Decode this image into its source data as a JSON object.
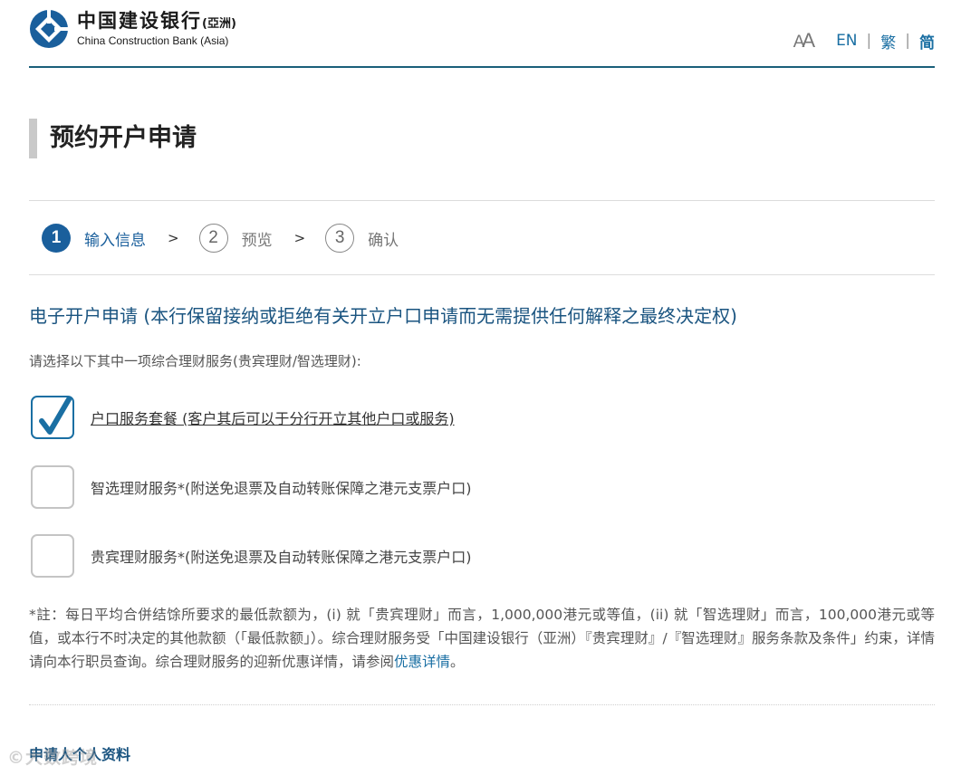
{
  "header": {
    "logo_cn": "中国建设银行",
    "logo_cn_suffix": "(亞洲)",
    "logo_en": "China Construction Bank (Asia)",
    "font_size_icon": "font-size-icon",
    "lang_en": "EN",
    "lang_tc": "繁",
    "lang_sc": "简",
    "lang_sep": "|"
  },
  "page_title": "预约开户申请",
  "steps": [
    {
      "number": "1",
      "label": "输入信息",
      "state": "active"
    },
    {
      "number": "2",
      "label": "预览",
      "state": "inactive"
    },
    {
      "number": "3",
      "label": "确认",
      "state": "inactive"
    }
  ],
  "step_arrow": ">",
  "section_heading": "电子开户申请 (本行保留接纳或拒绝有关开立户口申请而无需提供任何解释之最终决定权)",
  "instruction": "请选择以下其中一项综合理财服务(贵宾理财/智选理财):",
  "options": [
    {
      "label": "户口服务套餐 (客户其后可以于分行开立其他户口或服务)",
      "checked": true
    },
    {
      "label": "智选理财服务*(附送免退票及自动转账保障之港元支票户口)",
      "checked": false
    },
    {
      "label": "贵宾理财服务*(附送免退票及自动转账保障之港元支票户口)",
      "checked": false
    }
  ],
  "note": {
    "text": "*註：每日平均合併结馀所要求的最低款额为，(i) 就「贵宾理财」而言，1,000,000港元或等值，(ii) 就「智选理财」而言，100,000港元或等值，或本行不时决定的其他款额（「最低款额」）。综合理财服务受「中国建设银行（亚洲）『贵宾理财』/『智选理财』服务条款及条件」约束，详情请向本行职员查询。综合理财服务的迎新优惠详情，请参阅",
    "link": "优惠详情",
    "end": "。"
  },
  "sub_heading": "申请人个人资料",
  "watermark": "©大数跨境",
  "colors": {
    "brand_blue": "#1a5f9c",
    "link_blue": "#1a6fa3",
    "heading_blue": "#1a5480",
    "divider": "#1a5f7a"
  }
}
